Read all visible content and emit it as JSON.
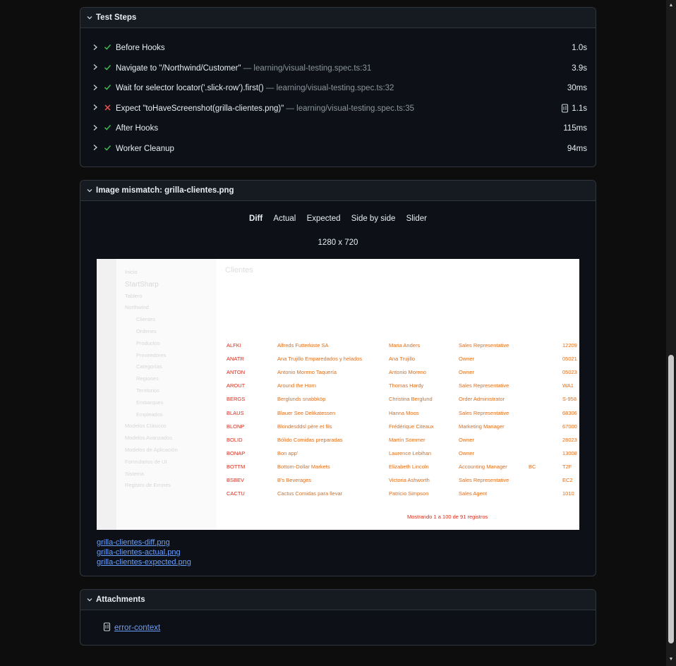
{
  "test_steps": {
    "title": "Test Steps",
    "steps": [
      {
        "status": "pass",
        "title": "Before Hooks",
        "location": "",
        "duration": "1.0s"
      },
      {
        "status": "pass",
        "title": "Navigate to \"/Northwind/Customer\"",
        "location": " — learning/visual-testing.spec.ts:31",
        "duration": "3.9s"
      },
      {
        "status": "pass",
        "title": "Wait for selector locator('.slick-row').first()",
        "location": " — learning/visual-testing.spec.ts:32",
        "duration": "30ms"
      },
      {
        "status": "fail",
        "title": "Expect \"toHaveScreenshot(grilla-clientes.png)\"",
        "location": " — learning/visual-testing.spec.ts:35",
        "duration": "1.1s",
        "attachment": true
      },
      {
        "status": "pass",
        "title": "After Hooks",
        "location": "",
        "duration": "115ms"
      },
      {
        "status": "pass",
        "title": "Worker Cleanup",
        "location": "",
        "duration": "94ms"
      }
    ]
  },
  "image_mismatch": {
    "title": "Image mismatch: grilla-clientes.png",
    "tabs": [
      "Diff",
      "Actual",
      "Expected",
      "Side by side",
      "Slider"
    ],
    "active_tab": "Diff",
    "dimensions": "1280 x 720",
    "snapshot": {
      "sidebar": [
        "Inicio",
        "StartSharp",
        "Tablero",
        "Northwind",
        "Clientes",
        "Ordenes",
        "Productos",
        "Proveedores",
        "Categorías",
        "Regiones",
        "Territorios",
        "Embarques",
        "Empleados",
        "Modelos Clásicos",
        "Modelos Avanzados",
        "Modelos de Aplicación",
        "Formularios de UI",
        "Sistema",
        "Registro de Errores"
      ],
      "page_title": "Clientes",
      "rows": [
        [
          "ALFKI",
          "Alfreds Futterkiste SA",
          "Maria Anders",
          "Sales Representative",
          "12209"
        ],
        [
          "ANATR",
          "Ana Trujillo Emparedados y helados",
          "Ana Trujillo",
          "Owner",
          "05021"
        ],
        [
          "ANTON",
          "Antonio Moreno Taquería",
          "Antonio Moreno",
          "Owner",
          "05023"
        ],
        [
          "AROUT",
          "Around the Horn",
          "Thomas Hardy",
          "Sales Representative",
          "WA1"
        ],
        [
          "BERGS",
          "Berglunds snabbköp",
          "Christina Berglund",
          "Order Administrator",
          "S-958"
        ],
        [
          "BLAUS",
          "Blauer See Delikatessen",
          "Hanna Moos",
          "Sales Representative",
          "68306"
        ],
        [
          "BLONP",
          "Blondesddsl père et fils",
          "Frédérique Citeaux",
          "Marketing Manager",
          "67000"
        ],
        [
          "BOLID",
          "Bólido Comidas preparadas",
          "Martín Sommer",
          "Owner",
          "28023"
        ],
        [
          "BONAP",
          "Bon app'",
          "Laurence Lebihan",
          "Owner",
          "13008"
        ],
        [
          "BOTTM",
          "Bottom-Dollar Markets",
          "Elizabeth Lincoln",
          "Accounting Manager",
          "T2F"
        ],
        [
          "BSBEV",
          "B's Beverages",
          "Victoria Ashworth",
          "Sales Representative",
          "EC2"
        ],
        [
          "CACTU",
          "Cactus Comidas para llevar",
          "Patricio Simpson",
          "Sales Agent",
          "1010"
        ]
      ],
      "region_cell": "BC",
      "footer_text": "Mostrando 1 a 100 de 91 registros"
    },
    "links": [
      "grilla-clientes-diff.png",
      "grilla-clientes-actual.png",
      "grilla-clientes-expected.png"
    ]
  },
  "attachments": {
    "title": "Attachments",
    "items": [
      "error-context"
    ]
  },
  "colors": {
    "pass": "#3fb950",
    "fail": "#f85149",
    "link": "#6a9fff",
    "diff_red": "#d82b1a",
    "diff_orange": "#e06d17"
  }
}
